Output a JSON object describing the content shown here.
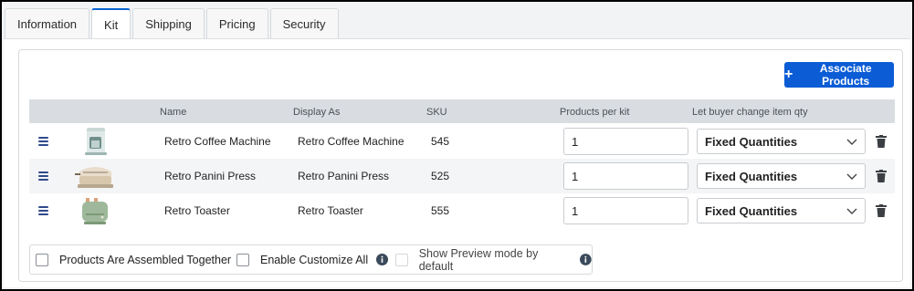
{
  "tabs": [
    {
      "label": "Information",
      "active": false
    },
    {
      "label": "Kit",
      "active": true
    },
    {
      "label": "Shipping",
      "active": false
    },
    {
      "label": "Pricing",
      "active": false
    },
    {
      "label": "Security",
      "active": false
    }
  ],
  "toolbar": {
    "associate_label": "Associate Products",
    "associate_icon": "plus-icon",
    "accent_color": "#0b5cd5"
  },
  "table": {
    "headers": {
      "name": "Name",
      "display_as": "Display As",
      "sku": "SKU",
      "products_per_kit": "Products per kit",
      "buyer_change": "Let buyer change item qty"
    },
    "rows": [
      {
        "name": "Retro Coffee Machine",
        "display_as": "Retro Coffee Machine",
        "sku": "545",
        "qty": "1",
        "qty_mode": "Fixed Quantities",
        "thumb": "coffee-machine-image"
      },
      {
        "name": "Retro Panini Press",
        "display_as": "Retro Panini Press",
        "sku": "525",
        "qty": "1",
        "qty_mode": "Fixed Quantities",
        "thumb": "panini-press-image"
      },
      {
        "name": "Retro Toaster",
        "display_as": "Retro Toaster",
        "sku": "555",
        "qty": "1",
        "qty_mode": "Fixed Quantities",
        "thumb": "toaster-image"
      }
    ]
  },
  "options": {
    "assembled_label": "Products Are Assembled Together",
    "customize_all_label": "Enable Customize All",
    "preview_label": "Show Preview mode by default"
  }
}
